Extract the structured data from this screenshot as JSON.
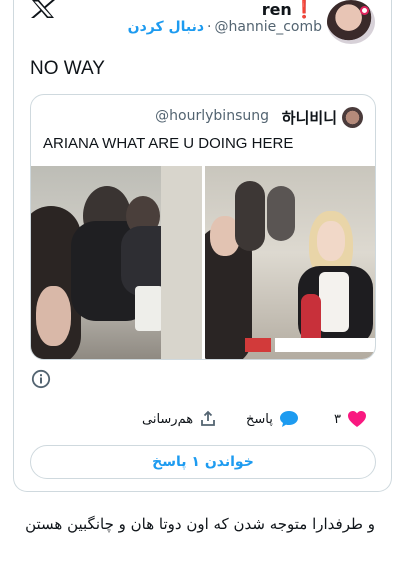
{
  "header": {
    "logo_icon": "x-logo-icon",
    "display_name": "ren",
    "name_emoji": "❗",
    "handle": "@hannie_comb",
    "separator": "·",
    "follow_label": "دنبال کردن"
  },
  "tweet": {
    "text": "NO WAY"
  },
  "quote": {
    "display_name": "하니비니",
    "handle": "@hourlybinsung",
    "text": "ARIANA WHAT ARE U DOING HERE",
    "images": [
      "photo-two-people-at-cafe",
      "photo-blonde-woman-at-table"
    ]
  },
  "actions": {
    "like_count": "۳",
    "reply_label": "پاسخ",
    "share_label": "هم‌رسانی"
  },
  "read_replies_label": "خواندن ۱ پاسخ",
  "caption": "و طرفدارا متوجه شدن که اون دوتا هان و چانگبین هستن",
  "colors": {
    "accent": "#1d9bf0",
    "like": "#f91880",
    "border": "#cfd9de",
    "secondary_text": "#536471"
  }
}
